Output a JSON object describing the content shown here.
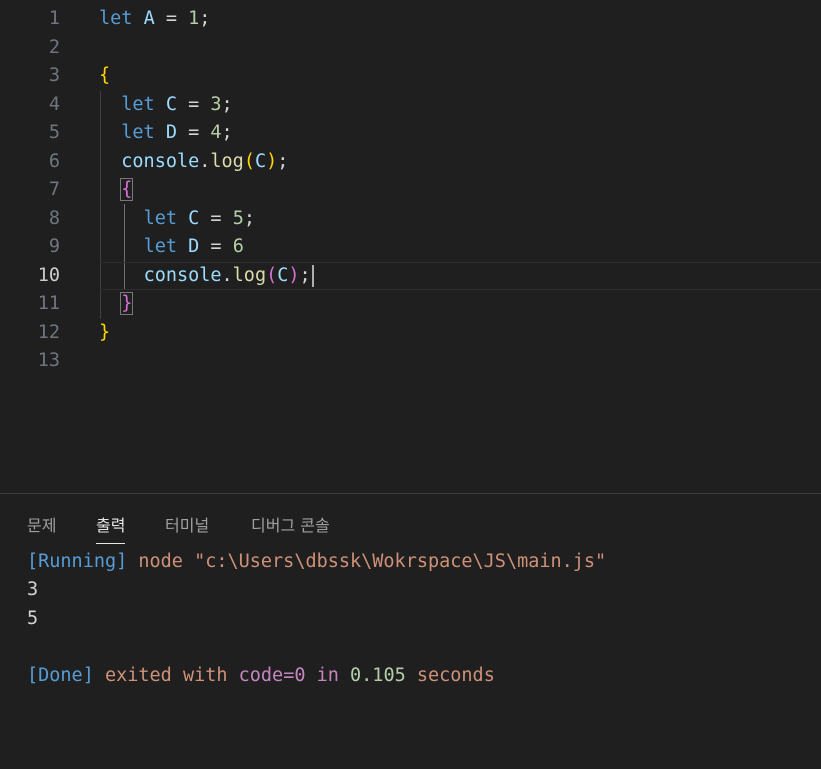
{
  "editor": {
    "line_numbers": [
      "1",
      "2",
      "3",
      "4",
      "5",
      "6",
      "7",
      "8",
      "9",
      "10",
      "11",
      "12",
      "13"
    ],
    "active_line": "10",
    "lines": {
      "l1": {
        "kw": "let",
        "var": "A",
        "op": " = ",
        "num": "1",
        "end": ";"
      },
      "l3": {
        "brace": "{"
      },
      "l4": {
        "kw": "let",
        "var": "C",
        "op": " = ",
        "num": "3",
        "end": ";"
      },
      "l5": {
        "kw": "let",
        "var": "D",
        "op": " = ",
        "num": "4",
        "end": ";"
      },
      "l6": {
        "obj": "console",
        "dot": ".",
        "fn": "log",
        "open": "(",
        "arg": "C",
        "close": ")",
        "end": ";"
      },
      "l7": {
        "brace": "{"
      },
      "l8": {
        "kw": "let",
        "var": "C",
        "op": " = ",
        "num": "5",
        "end": ";"
      },
      "l9": {
        "kw": "let",
        "var": "D",
        "op": " = ",
        "num": "6"
      },
      "l10": {
        "obj": "console",
        "dot": ".",
        "fn": "log",
        "open": "(",
        "arg": "C",
        "close": ")",
        "end": ";"
      },
      "l11": {
        "brace": "}"
      },
      "l12": {
        "brace": "}"
      }
    }
  },
  "panel": {
    "tabs": [
      "문제",
      "출력",
      "터미널",
      "디버그 콘솔"
    ],
    "active_tab": "출력",
    "output": {
      "running_tag": "[Running]",
      "running_cmd": " node \"c:\\Users\\dbssk\\Wokrspace\\JS\\main.js\"",
      "line1": "3",
      "line2": "5",
      "done_tag": "[Done]",
      "done_text1": " exited ",
      "done_with": "with",
      "done_code": " code=",
      "done_code_val": "0",
      "done_in": " in ",
      "done_secs": "0.105",
      "done_seconds": " seconds"
    }
  },
  "colors": {
    "background": "#1f1f1f",
    "keyword": "#569cd6",
    "variable": "#9cdcfe",
    "number": "#b5cea8",
    "function": "#dcdcaa",
    "bracket": "#ffd700",
    "string": "#ce9178",
    "purple": "#c586c0"
  }
}
